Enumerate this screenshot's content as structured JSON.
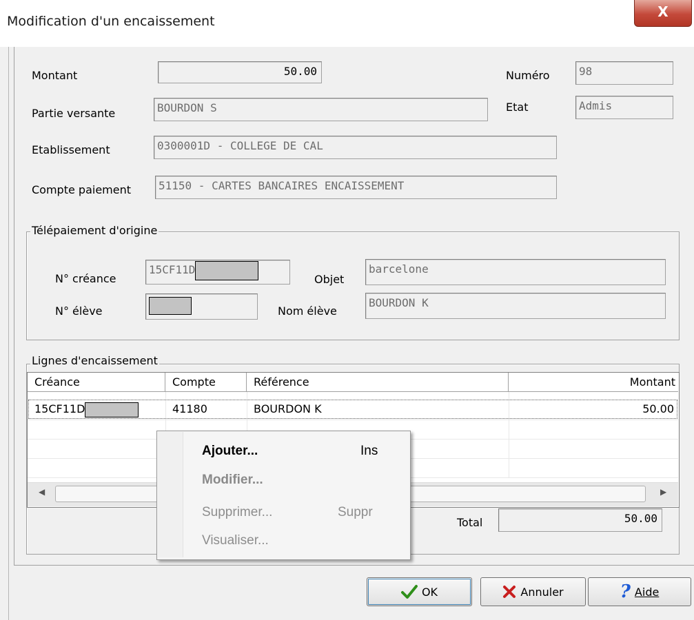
{
  "window": {
    "title": "Modification d'un encaissement",
    "close_glyph": "X"
  },
  "form": {
    "montant": {
      "label": "Montant",
      "value": "50.00"
    },
    "partie": {
      "label": "Partie versante",
      "value": "BOURDON S"
    },
    "etablissement": {
      "label": "Etablissement",
      "value": "0300001D - COLLEGE DE CAL"
    },
    "compte": {
      "label": "Compte paiement",
      "value": "51150 - CARTES BANCAIRES ENCAISSEMENT"
    },
    "numero": {
      "label": "Numéro",
      "value": "98"
    },
    "etat": {
      "label": "Etat",
      "value": "Admis"
    }
  },
  "telepaiement": {
    "title": "Télépaiement d'origine",
    "creance": {
      "label": "N° créance",
      "value": "15CF11D"
    },
    "objet": {
      "label": "Objet",
      "value": "barcelone"
    },
    "eleve": {
      "label": "N° élève",
      "value": ""
    },
    "nom": {
      "label": "Nom élève",
      "value": "BOURDON K"
    }
  },
  "lignes": {
    "title": "Lignes d'encaissement",
    "columns": [
      "Créance",
      "Compte",
      "Référence",
      "Montant"
    ],
    "rows": [
      {
        "creance": "15CF11D",
        "compte": "41180",
        "reference": "BOURDON K",
        "montant": "50.00"
      }
    ],
    "total_label": "Total",
    "total_value": "50.00"
  },
  "context_menu": {
    "items": [
      {
        "label": "Ajouter...",
        "shortcut": "Ins",
        "state": "enabled"
      },
      {
        "label": "Modifier...",
        "shortcut": "",
        "state": "bold-disabled"
      },
      {
        "label": "Supprimer...",
        "shortcut": "Suppr",
        "state": "disabled"
      },
      {
        "label": "Visualiser...",
        "shortcut": "",
        "state": "disabled"
      }
    ]
  },
  "buttons": {
    "ok": {
      "label": "OK",
      "icon": "check-icon"
    },
    "annuler": {
      "label": "Annuler",
      "icon": "x-icon"
    },
    "aide": {
      "label": "Aide",
      "icon": "help-icon"
    }
  },
  "colors": {
    "check": "#2f8f1a",
    "cancel": "#c81e1e",
    "help": "#1e5bd6"
  }
}
